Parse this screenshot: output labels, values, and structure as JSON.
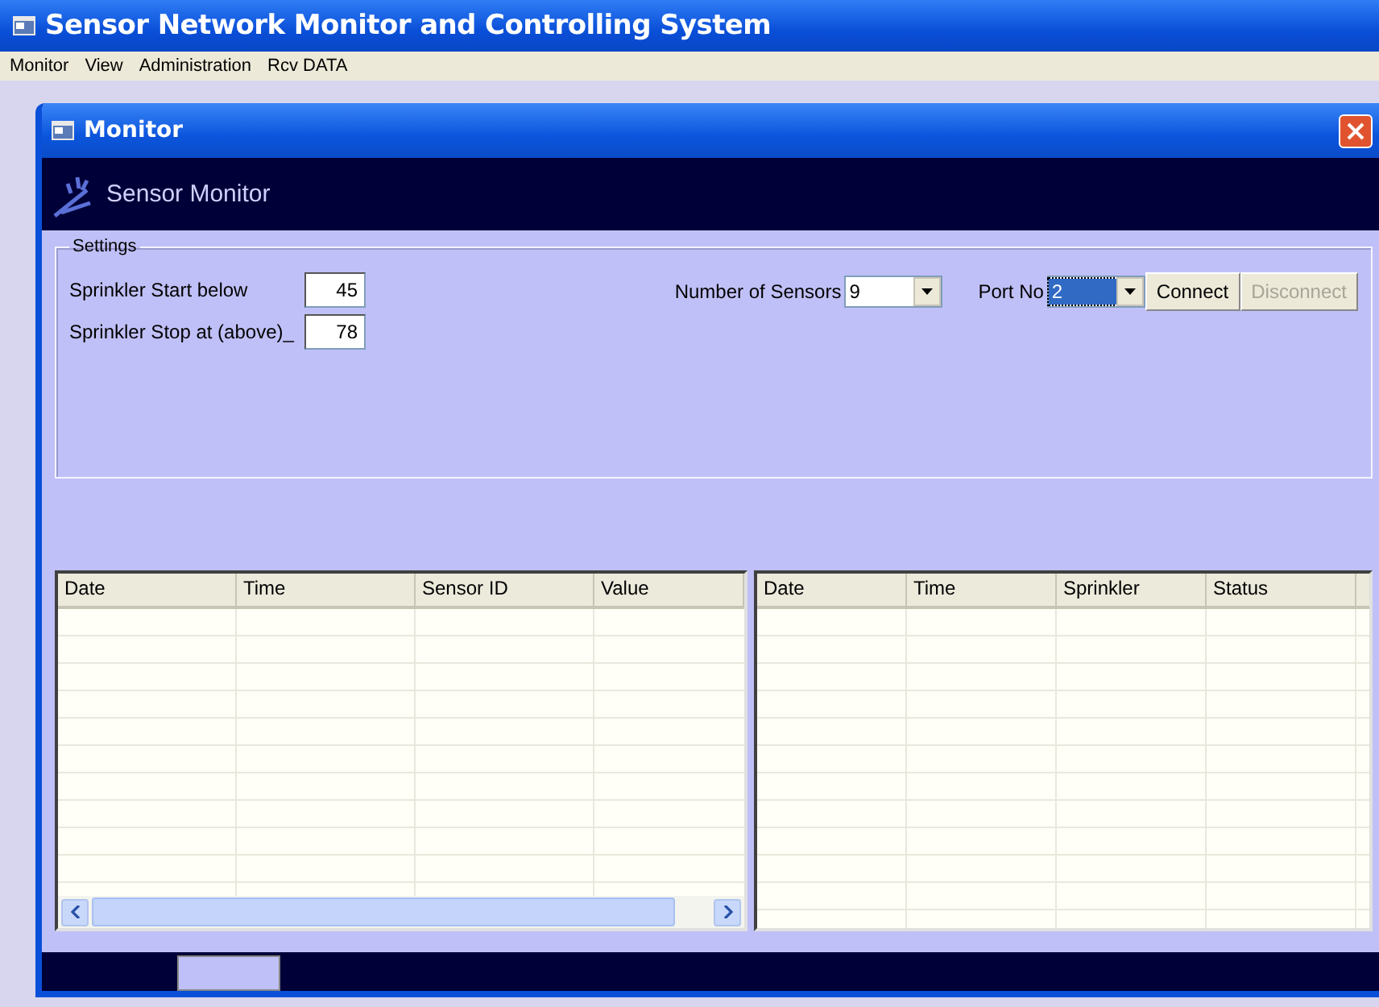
{
  "window": {
    "title": "Sensor Network Monitor and Controlling System"
  },
  "menu": [
    "Monitor",
    "View",
    "Administration",
    "Rcv DATA"
  ],
  "child_window": {
    "title": "Monitor",
    "banner": "Sensor Monitor"
  },
  "settings": {
    "title": "Settings",
    "fields": [
      {
        "label": "Sprinkler Start below",
        "value": "45"
      },
      {
        "label": "Sprinkler Stop at (above)_",
        "value": "78"
      }
    ],
    "sensors": {
      "label": "Number of Sensors",
      "value": "9",
      "selected": false
    },
    "port": {
      "label": "Port No",
      "value": "2",
      "selected": true
    },
    "buttons": [
      {
        "label": "Connect",
        "disabled": false
      },
      {
        "label": "Disconnect",
        "disabled": true
      }
    ]
  },
  "readings_table": {
    "columns": [
      "Date",
      "Time",
      "Sensor ID",
      "Value"
    ]
  },
  "sprinkler_table": {
    "columns": [
      "Date",
      "Time",
      "Sprinkler",
      "Status"
    ]
  },
  "status_tabs": [
    {
      "selected": true
    }
  ]
}
